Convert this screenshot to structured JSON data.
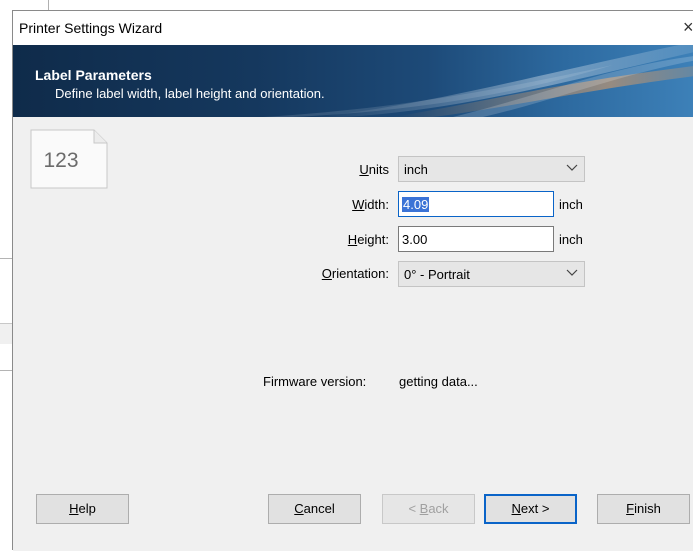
{
  "window": {
    "title": "Printer Settings Wizard",
    "close_glyph": "×"
  },
  "banner": {
    "title": "Label Parameters",
    "subtitle": "Define label width, label height and orientation."
  },
  "icon": {
    "name": "label-document-icon",
    "text": "123"
  },
  "form": {
    "units": {
      "label_prefix": "",
      "label_accel": "U",
      "label_rest": "nits",
      "value": "inch"
    },
    "width": {
      "label_accel": "W",
      "label_rest": "idth:",
      "value": "4.09",
      "unit": "inch"
    },
    "height": {
      "label_accel": "H",
      "label_rest": "eight:",
      "value": "3.00",
      "unit": "inch"
    },
    "orientation": {
      "label_accel": "O",
      "label_rest": "rientation:",
      "value": "0° - Portrait"
    }
  },
  "firmware": {
    "label": "Firmware version:",
    "value": "getting data..."
  },
  "buttons": {
    "help": {
      "accel": "H",
      "rest": "elp"
    },
    "cancel": {
      "accel": "C",
      "rest": "ancel"
    },
    "back": {
      "prefix": "< ",
      "accel": "B",
      "rest": "ack"
    },
    "next": {
      "accel": "N",
      "rest": "ext >"
    },
    "finish": {
      "accel": "F",
      "rest": "inish"
    }
  },
  "colors": {
    "banner_dark": "#0f2b4a",
    "banner_light": "#3e82ba",
    "focus_border": "#0a64c8",
    "selection": "#3b73d6"
  }
}
